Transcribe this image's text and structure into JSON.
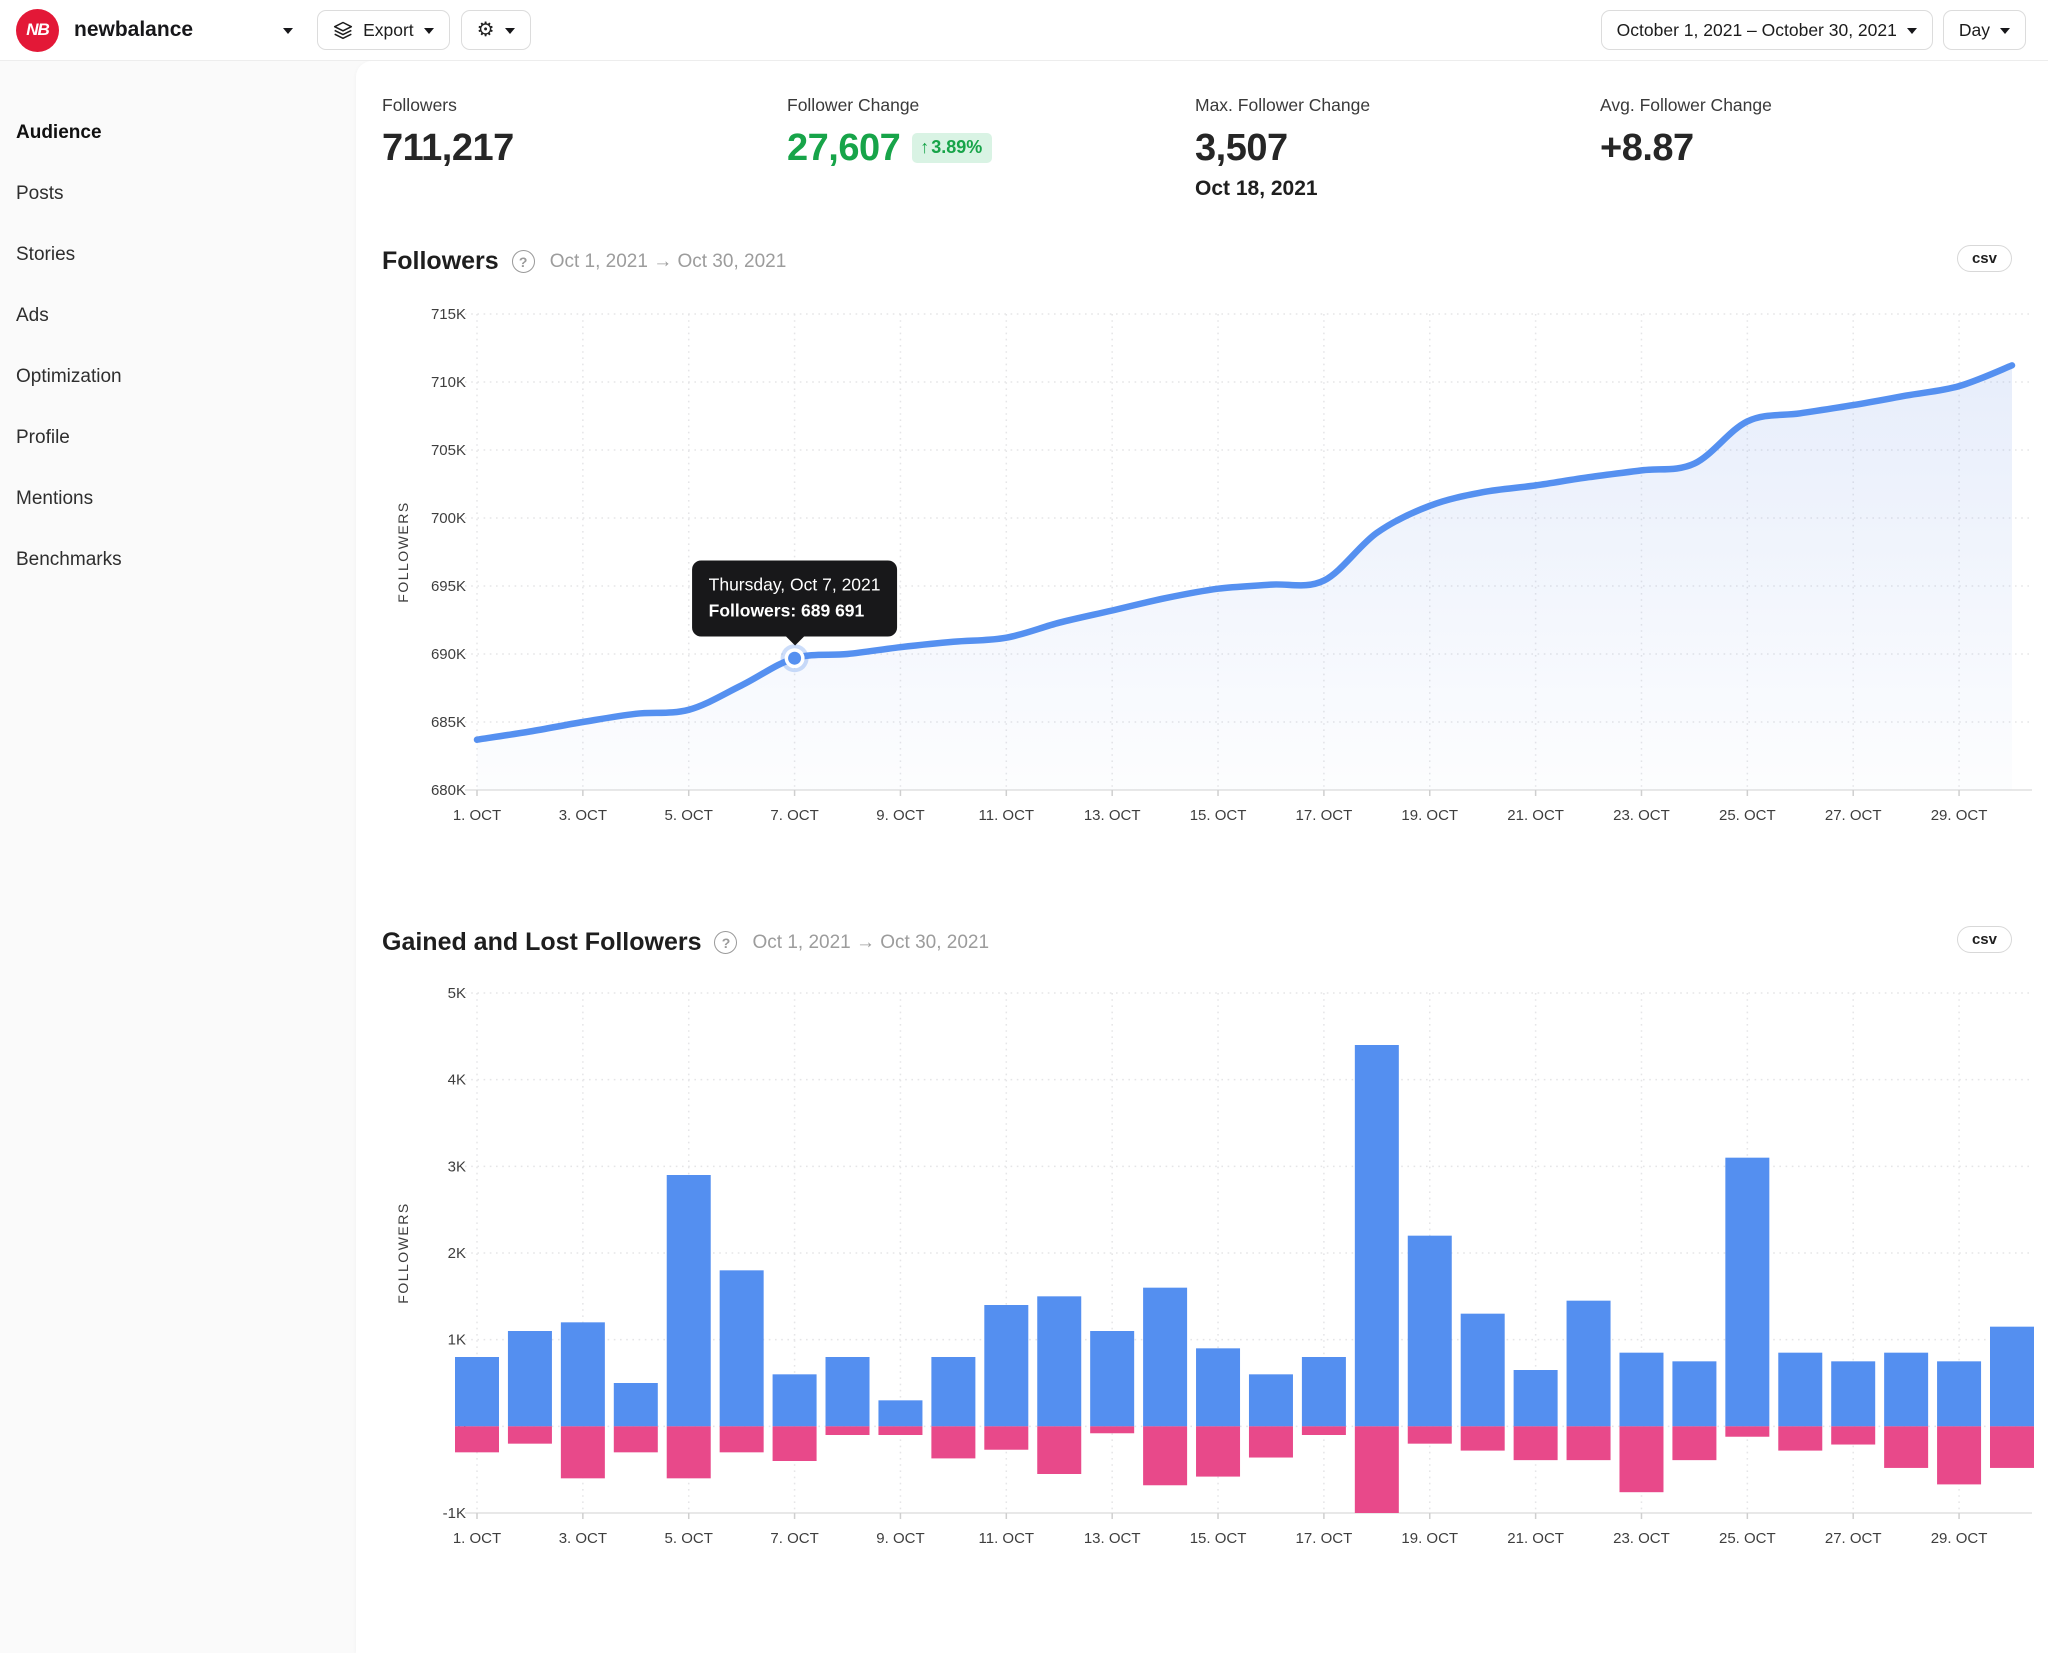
{
  "icons": {
    "gear": "⚙",
    "up_arrow": "↑",
    "help": "?"
  },
  "topbar": {
    "logo_text": "NB",
    "account_name": "newbalance",
    "export_label": "Export",
    "date_range_label": "October 1, 2021 – October 30, 2021",
    "granularity_label": "Day"
  },
  "sidebar": {
    "items": [
      {
        "label": "Audience",
        "active": true
      },
      {
        "label": "Posts",
        "active": false
      },
      {
        "label": "Stories",
        "active": false
      },
      {
        "label": "Ads",
        "active": false
      },
      {
        "label": "Optimization",
        "active": false
      },
      {
        "label": "Profile",
        "active": false
      },
      {
        "label": "Mentions",
        "active": false
      },
      {
        "label": "Benchmarks",
        "active": false
      }
    ]
  },
  "stats": [
    {
      "label": "Followers",
      "value": "711,217"
    },
    {
      "label": "Follower Change",
      "value": "27,607",
      "badge": "3.89%"
    },
    {
      "label": "Max. Follower Change",
      "value": "3,507",
      "sub": "Oct 18, 2021"
    },
    {
      "label": "Avg. Follower Change",
      "value": "+8.87"
    }
  ],
  "sections": {
    "followers": {
      "title": "Followers",
      "range": "Oct 1, 2021 → Oct 30, 2021",
      "csv_label": "csv"
    },
    "gained_lost": {
      "title": "Gained and Lost Followers",
      "range": "Oct 1, 2021 → Oct 30, 2021",
      "csv_label": "csv"
    }
  },
  "tooltip": {
    "line1": "Thursday, Oct 7, 2021",
    "line2": "Followers: 689 691"
  },
  "chart_data": [
    {
      "type": "line",
      "title": "Followers",
      "ylabel": "FOLLOWERS",
      "days": [
        1,
        2,
        3,
        4,
        5,
        6,
        7,
        8,
        9,
        10,
        11,
        12,
        13,
        14,
        15,
        16,
        17,
        18,
        19,
        20,
        21,
        22,
        23,
        24,
        25,
        26,
        27,
        28,
        29,
        30
      ],
      "series": [
        {
          "name": "Followers",
          "values": [
            683700,
            684300,
            685000,
            685600,
            685900,
            687700,
            689691,
            690000,
            690500,
            690900,
            691200,
            692300,
            693200,
            694100,
            694800,
            695100,
            695400,
            698907,
            700900,
            701900,
            702400,
            703000,
            703500,
            704000,
            707100,
            707700,
            708300,
            709000,
            709700,
            711217
          ]
        }
      ],
      "ylim": [
        680000,
        715000
      ],
      "y_tick_values": [
        715000,
        710000,
        705000,
        700000,
        695000,
        690000,
        685000,
        680000
      ],
      "y_tick_labels": [
        "715K",
        "710K",
        "705K",
        "700K",
        "695K",
        "690K",
        "685K",
        "680K"
      ],
      "x_tick_indices": [
        0,
        2,
        4,
        6,
        8,
        10,
        12,
        14,
        16,
        18,
        20,
        22,
        24,
        26,
        28
      ],
      "x_tick_labels": [
        "1. OCT",
        "3. OCT",
        "5. OCT",
        "7. OCT",
        "9. OCT",
        "11. OCT",
        "13. OCT",
        "15. OCT",
        "17. OCT",
        "19. OCT",
        "21. OCT",
        "23. OCT",
        "25. OCT",
        "27. OCT",
        "29. OCT"
      ],
      "highlight": {
        "index": 6,
        "value": 689691,
        "label": "Thursday, Oct 7, 2021"
      },
      "line_color": "#5590f0",
      "grid": true,
      "legend": "none"
    },
    {
      "type": "bar",
      "title": "Gained and Lost Followers",
      "ylabel": "FOLLOWERS",
      "categories": [
        1,
        2,
        3,
        4,
        5,
        6,
        7,
        8,
        9,
        10,
        11,
        12,
        13,
        14,
        15,
        16,
        17,
        18,
        19,
        20,
        21,
        22,
        23,
        24,
        25,
        26,
        27,
        28,
        29,
        30
      ],
      "series": [
        {
          "name": "Gained Followers",
          "color": "#548ff0",
          "values": [
            800,
            1100,
            1200,
            500,
            2900,
            1800,
            600,
            800,
            300,
            800,
            1400,
            1500,
            1100,
            1600,
            900,
            600,
            800,
            4400,
            2200,
            1300,
            650,
            1450,
            850,
            750,
            3100,
            850,
            750,
            850,
            750,
            1150
          ]
        },
        {
          "name": "Lost Followers",
          "color": "#e8498a",
          "values": [
            -300,
            -200,
            -600,
            -300,
            -600,
            -300,
            -400,
            -100,
            -100,
            -370,
            -270,
            -550,
            -80,
            -680,
            -580,
            -360,
            -100,
            -1000,
            -200,
            -280,
            -390,
            -390,
            -760,
            -390,
            -120,
            -280,
            -210,
            -480,
            -670,
            -480
          ]
        }
      ],
      "ylim": [
        -1000,
        5000
      ],
      "y_tick_values": [
        5000,
        4000,
        3000,
        2000,
        1000,
        0,
        -1000
      ],
      "y_tick_labels": [
        "5K",
        "4K",
        "3K",
        "2K",
        "1K",
        "0",
        "-1K"
      ],
      "x_tick_indices": [
        0,
        2,
        4,
        6,
        8,
        10,
        12,
        14,
        16,
        18,
        20,
        22,
        24,
        26,
        28
      ],
      "x_tick_labels": [
        "1. OCT",
        "3. OCT",
        "5. OCT",
        "7. OCT",
        "9. OCT",
        "11. OCT",
        "13. OCT",
        "15. OCT",
        "17. OCT",
        "19. OCT",
        "21. OCT",
        "23. OCT",
        "25. OCT",
        "27. OCT",
        "29. OCT"
      ],
      "grid": true,
      "legend": "none"
    }
  ]
}
